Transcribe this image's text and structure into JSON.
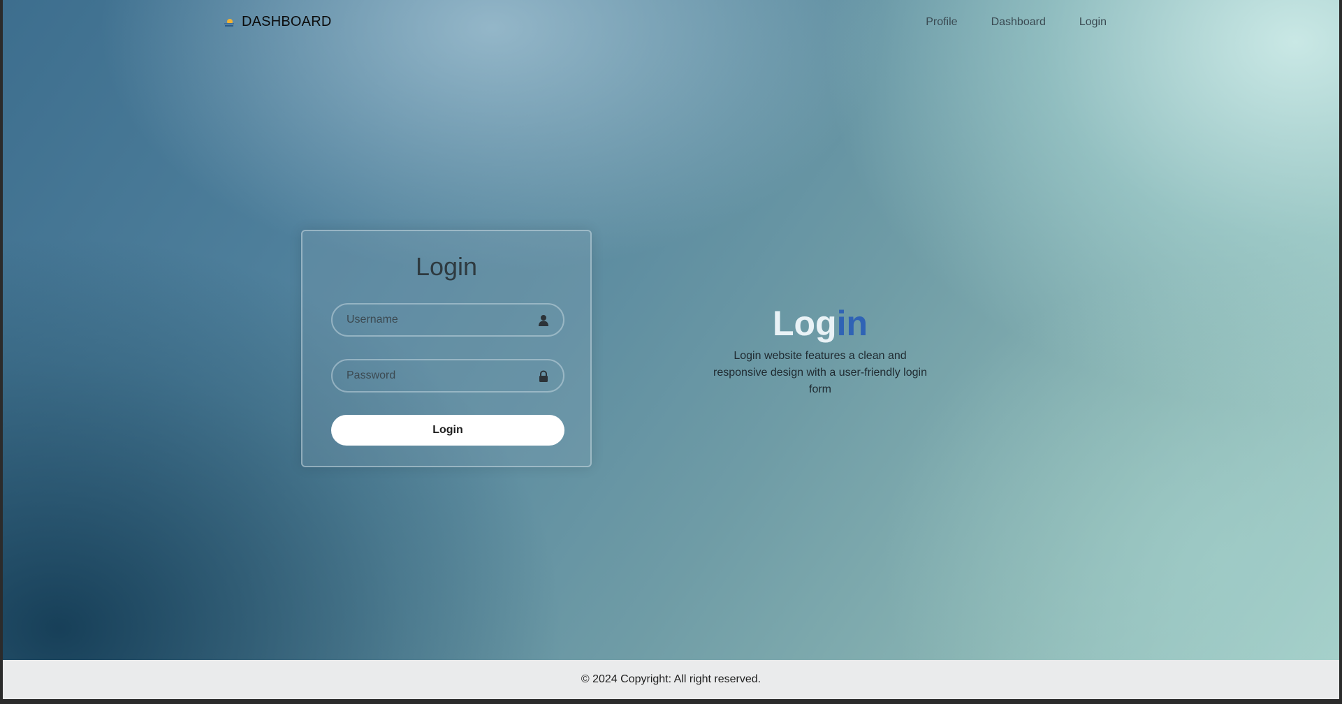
{
  "navbar": {
    "brand_icon": "sun-over-water-logo-icon",
    "brand_text": "DASHBOARD",
    "links": [
      {
        "label": "Profile"
      },
      {
        "label": "Dashboard"
      },
      {
        "label": "Login"
      }
    ]
  },
  "login_form": {
    "title": "Login",
    "username": {
      "placeholder": "Username",
      "value": "",
      "icon": "user-icon"
    },
    "password": {
      "placeholder": "Password",
      "value": "",
      "icon": "lock-icon"
    },
    "submit_label": "Login"
  },
  "promo": {
    "heading_part_a": "Log",
    "heading_part_b": "in",
    "description": "Login website features a clean and responsive design with a user-friendly login form"
  },
  "footer": {
    "text": "© 2024 Copyright: All right reserved."
  },
  "colors": {
    "accent_blue": "#2f63b5",
    "button_bg": "#ffffff",
    "footer_bg": "#eaebec"
  }
}
